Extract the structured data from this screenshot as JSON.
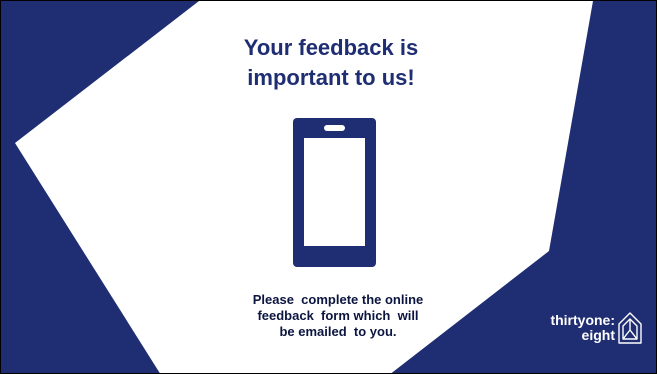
{
  "slide": {
    "title_line1": "Your feedback is",
    "title_line2": "important to us!",
    "icon": "smartphone-icon",
    "caption_line1": "Please  complete the online",
    "caption_line2": "feedback  form which  will",
    "caption_line3": "be emailed  to you."
  },
  "logo": {
    "line1": "thirtyone:",
    "line2": "eight",
    "mark": "house-logo-icon"
  },
  "colors": {
    "navy": "#1f2e72",
    "dark_navy": "#0c1540",
    "white": "#ffffff"
  }
}
